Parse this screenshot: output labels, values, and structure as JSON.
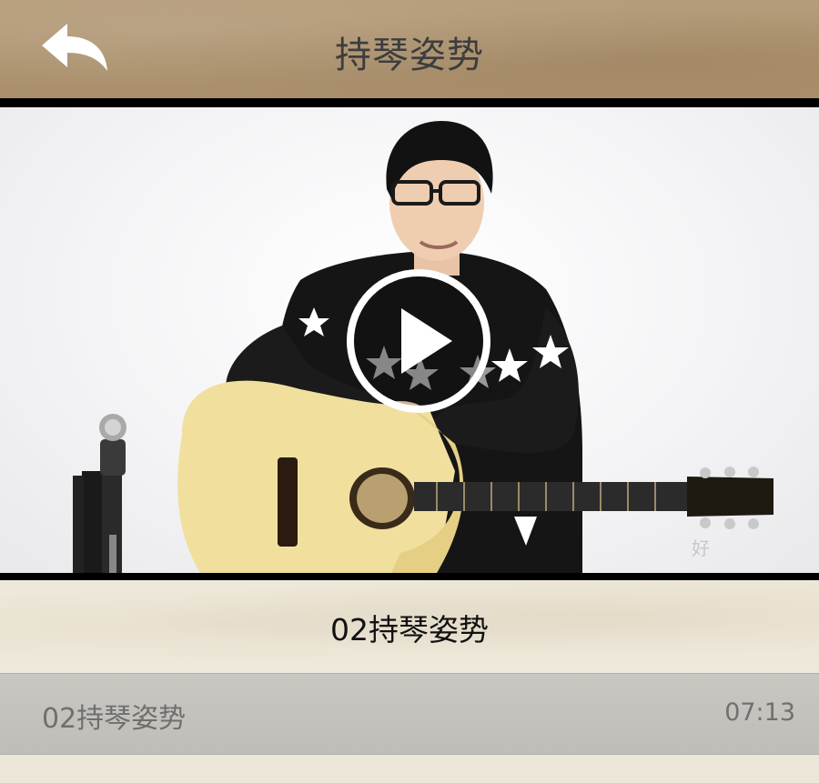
{
  "header": {
    "title": "持琴姿势",
    "back_icon": "back-arrow-icon"
  },
  "video": {
    "watermark": "好",
    "play_icon": "play-icon"
  },
  "caption": {
    "title": "02持琴姿势"
  },
  "episodes": [
    {
      "title": "02持琴姿势",
      "duration": "07:13"
    }
  ],
  "colors": {
    "header_bg": "#ab916e",
    "title_text": "#3d3d3d",
    "episode_row_bg": "#c6c4bf"
  }
}
